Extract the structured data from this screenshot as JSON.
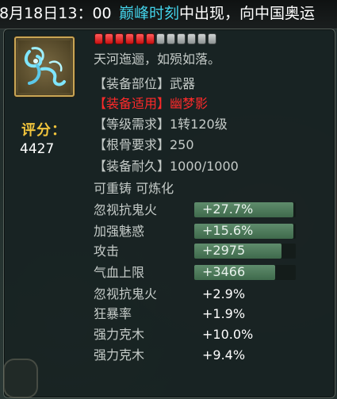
{
  "ticker": {
    "part1": "8月18日13：00",
    "part2": "巅峰时刻",
    "part3": "中出现，向中国奥运",
    "colors": {
      "highlight": "#43d1e8",
      "normal": "#ffffff"
    }
  },
  "item": {
    "icon": "feather-whip-icon",
    "score_label": "评分：",
    "score_value": "4427",
    "stars_total": 12,
    "stars_filled": 6,
    "description": "天河迤逦，如殒如落。",
    "slot_label": "【装备部位】武器",
    "class_label": "【装备适用】幽梦影",
    "level_label": "【等级需求】1转120级",
    "root_label": "【根骨要求】250",
    "durability_label": "【装备耐久】1000/1000",
    "recast_label": "可重铸 可炼化"
  },
  "attributes_bar": [
    {
      "name": "忽视抗鬼火",
      "value": "+27.7%",
      "fill": 0.98
    },
    {
      "name": "加强魅惑",
      "value": "+15.6%",
      "fill": 0.98
    },
    {
      "name": "攻击",
      "value": "+2975",
      "fill": 0.86
    },
    {
      "name": "气血上限",
      "value": "+3466",
      "fill": 0.8
    }
  ],
  "attributes_plain": [
    {
      "name": "忽视抗鬼火",
      "value": "+2.9%"
    },
    {
      "name": "狂暴率",
      "value": "+1.9%"
    },
    {
      "name": "强力克木",
      "value": "+10.0%"
    },
    {
      "name": "强力克木",
      "value": "+9.4%"
    }
  ]
}
